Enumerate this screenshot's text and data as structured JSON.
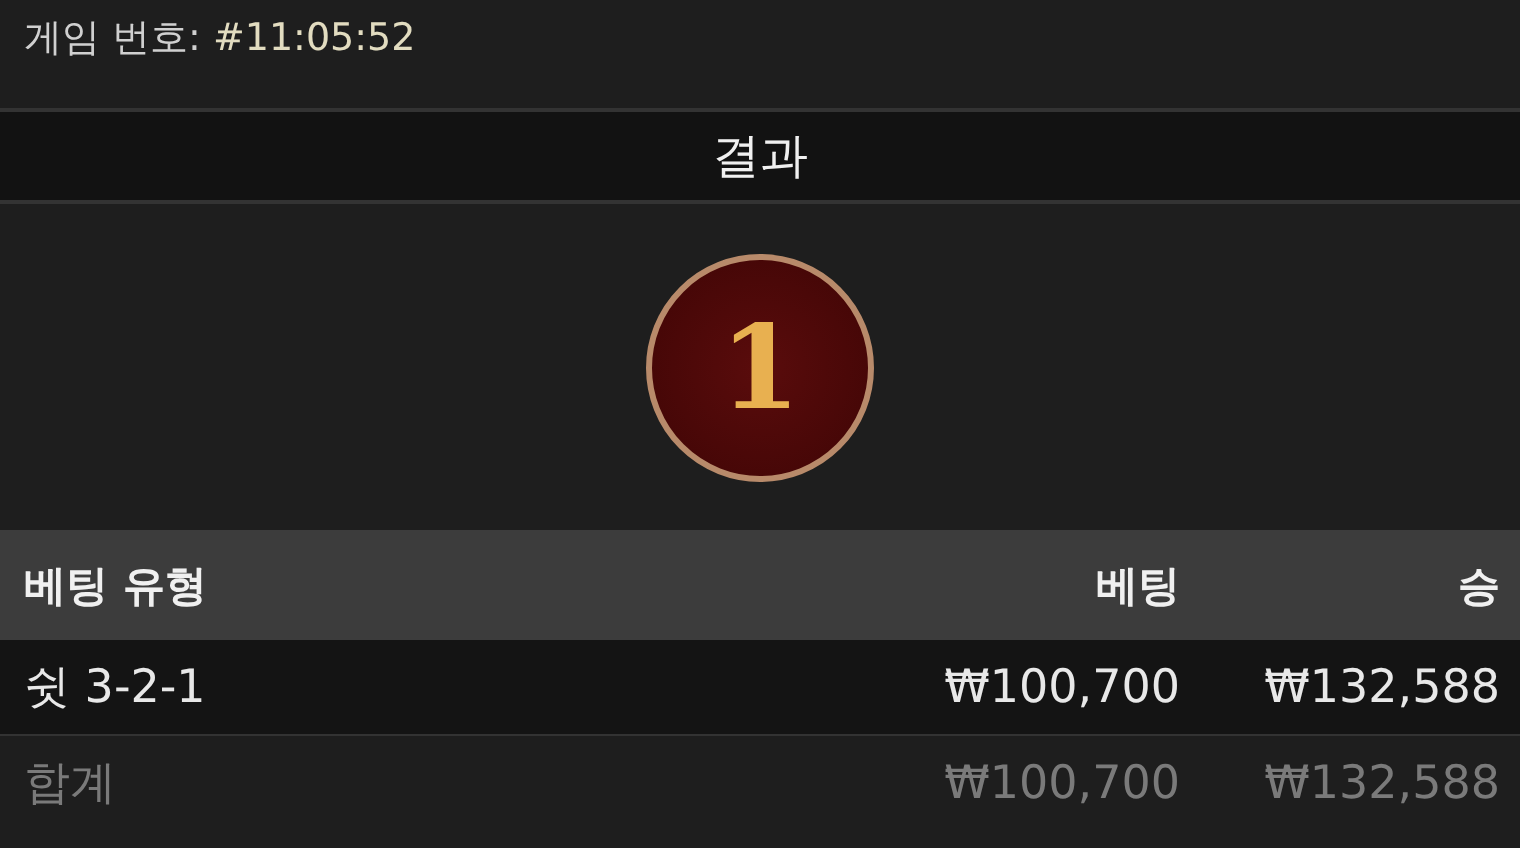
{
  "game": {
    "label": "게임 번호:",
    "value": "#11:05:52"
  },
  "result": {
    "title": "결과",
    "number": "1"
  },
  "table": {
    "columns": [
      "베팅 유형",
      "베팅",
      "승"
    ],
    "rows": [
      {
        "kind": "bet",
        "cells": [
          "쉿 3-2-1",
          "₩100,700",
          "₩132,588"
        ]
      },
      {
        "kind": "total",
        "cells": [
          "합계",
          "₩100,700",
          "₩132,588"
        ]
      }
    ]
  }
}
